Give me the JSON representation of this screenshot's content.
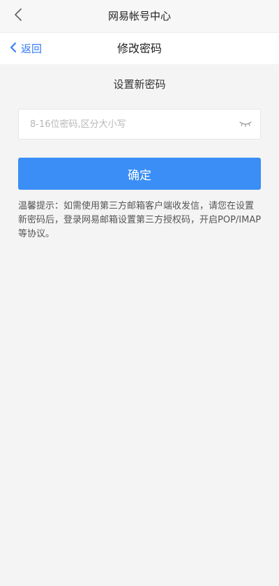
{
  "header": {
    "title": "网易帐号中心"
  },
  "nav": {
    "back_label": "返回",
    "title": "修改密码"
  },
  "form": {
    "section_title": "设置新密码",
    "password_placeholder": "8-16位密码,区分大小写",
    "password_value": "",
    "confirm_label": "确定"
  },
  "tip": {
    "text": "温馨提示：如需使用第三方邮箱客户端收发信，请您在设置新密码后，登录网易邮箱设置第三方授权码，开启POP/IMAP等协议。"
  },
  "colors": {
    "accent": "#2f7bf6",
    "button": "#3a8ef6",
    "background": "#f4f4f4"
  },
  "icons": {
    "top_back": "chevron-left-icon",
    "nav_back": "chevron-left-icon",
    "password_toggle": "eye-closed-icon"
  }
}
